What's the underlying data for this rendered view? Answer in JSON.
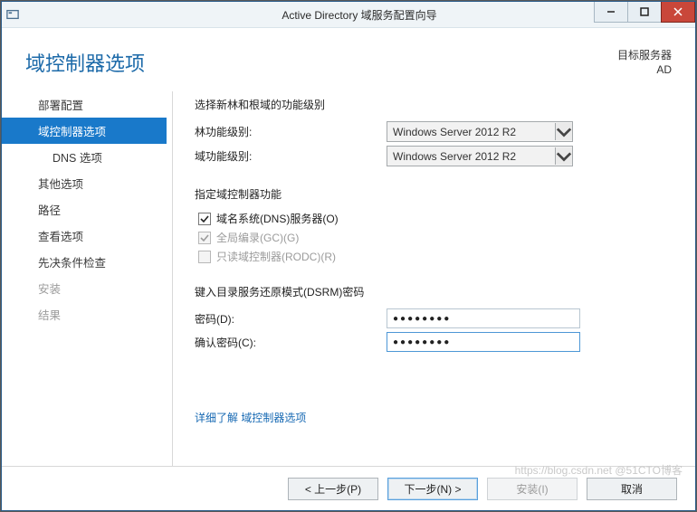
{
  "window": {
    "title": "Active Directory 域服务配置向导"
  },
  "header": {
    "page_title": "域控制器选项",
    "target_label": "目标服务器",
    "target_value": "AD"
  },
  "sidebar": {
    "items": [
      {
        "label": "部署配置"
      },
      {
        "label": "域控制器选项"
      },
      {
        "label": "DNS 选项"
      },
      {
        "label": "其他选项"
      },
      {
        "label": "路径"
      },
      {
        "label": "查看选项"
      },
      {
        "label": "先决条件检查"
      },
      {
        "label": "安装"
      },
      {
        "label": "结果"
      }
    ]
  },
  "main": {
    "func_level_heading": "选择新林和根域的功能级别",
    "forest_level_label": "林功能级别:",
    "forest_level_value": "Windows Server 2012 R2",
    "domain_level_label": "域功能级别:",
    "domain_level_value": "Windows Server 2012 R2",
    "capabilities_heading": "指定域控制器功能",
    "chk_dns": "域名系统(DNS)服务器(O)",
    "chk_gc": "全局编录(GC)(G)",
    "chk_rodc": "只读域控制器(RODC)(R)",
    "dsrm_heading": "键入目录服务还原模式(DSRM)密码",
    "pwd_label": "密码(D):",
    "pwd_value": "●●●●●●●●",
    "pwd_confirm_label": "确认密码(C):",
    "pwd_confirm_value": "●●●●●●●●",
    "more_link": "详细了解 域控制器选项"
  },
  "footer": {
    "prev": "< 上一步(P)",
    "next": "下一步(N) >",
    "install": "安装(I)",
    "cancel": "取消"
  },
  "watermark": "https://blog.csdn.net @51CTO博客"
}
